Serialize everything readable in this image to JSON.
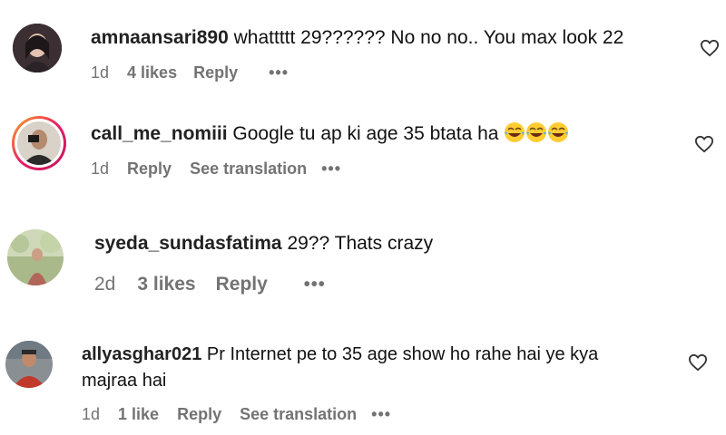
{
  "comments": [
    {
      "username": "amnaansari890",
      "text": "whattttt 29?????? No no no.. You max look 22",
      "time": "1d",
      "likes": "4 likes",
      "reply": "Reply",
      "more": "•••"
    },
    {
      "username": "call_me_nomiii",
      "text": "Google tu ap ki age 35 btata ha",
      "time": "1d",
      "reply": "Reply",
      "translate": "See translation",
      "more": "•••"
    },
    {
      "username": "syeda_sundasfatima",
      "text": "29?? Thats crazy",
      "time": "2d",
      "likes": "3 likes",
      "reply": "Reply",
      "more": "•••"
    },
    {
      "username": "allyasghar021",
      "text_line1": "Pr Internet pe to 35 age show ho rahe hai ye kya",
      "text_line2": "majraa hai",
      "time": "1d",
      "likes": "1 like",
      "reply": "Reply",
      "translate": "See translation",
      "more": "•••"
    }
  ],
  "icons": {
    "heart": "heart-outline-icon",
    "emoji": "face-with-tears-of-joy"
  },
  "colors": {
    "meta": "#737373",
    "text": "#111111",
    "story_ring_start": "#f9a825",
    "story_ring_end": "#c2185b"
  }
}
